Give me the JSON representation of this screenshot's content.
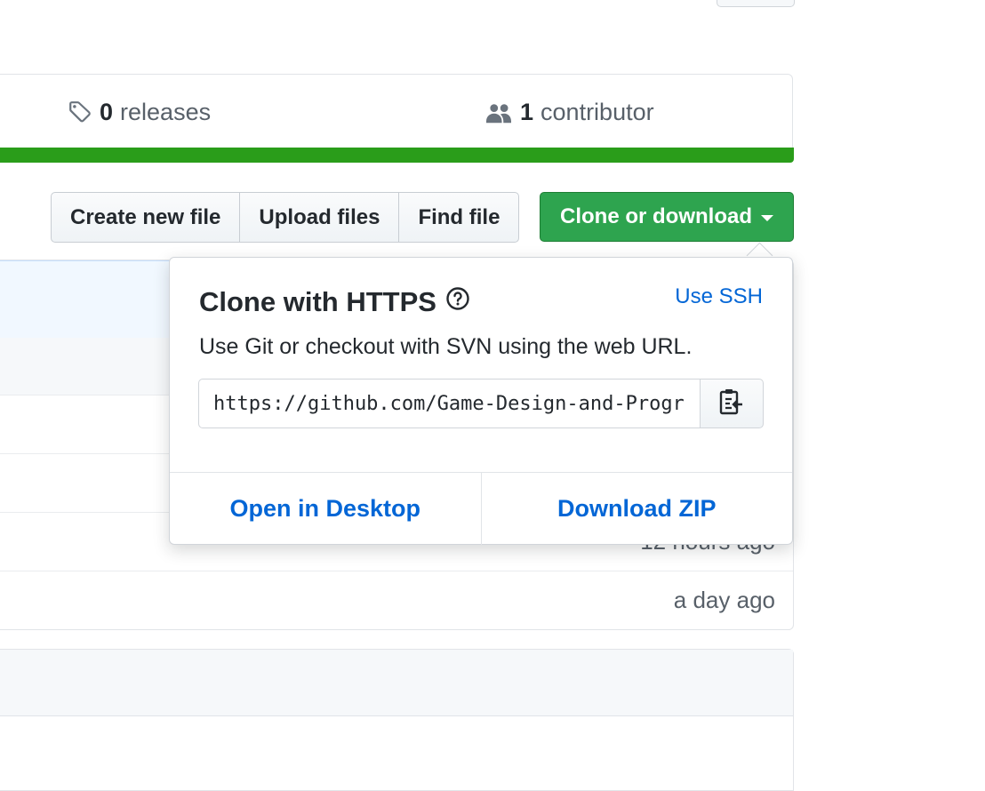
{
  "stats": {
    "releases_count": "0",
    "releases_label": "releases",
    "contributors_count": "1",
    "contributors_label": "contributor"
  },
  "toolbar": {
    "create_new_file": "Create new file",
    "upload_files": "Upload files",
    "find_file": "Find file",
    "clone_or_download": "Clone or download"
  },
  "file_rows": {
    "ages": [
      "12 hours ago",
      "a day ago"
    ]
  },
  "clone_dropdown": {
    "title": "Clone with HTTPS",
    "use_ssh": "Use SSH",
    "description": "Use Git or checkout with SVN using the web URL.",
    "url": "https://github.com/Game-Design-and-Progra",
    "open_in_desktop": "Open in Desktop",
    "download_zip": "Download ZIP"
  },
  "colors": {
    "primary_green": "#2ea44f",
    "link_blue": "#0366d6",
    "language_bar": "#2a9d1a"
  },
  "icons": {
    "releases": "tag-icon",
    "contributors": "people-icon",
    "help": "question-circle-icon",
    "copy": "clipboard-icon",
    "caret": "caret-down-icon"
  }
}
